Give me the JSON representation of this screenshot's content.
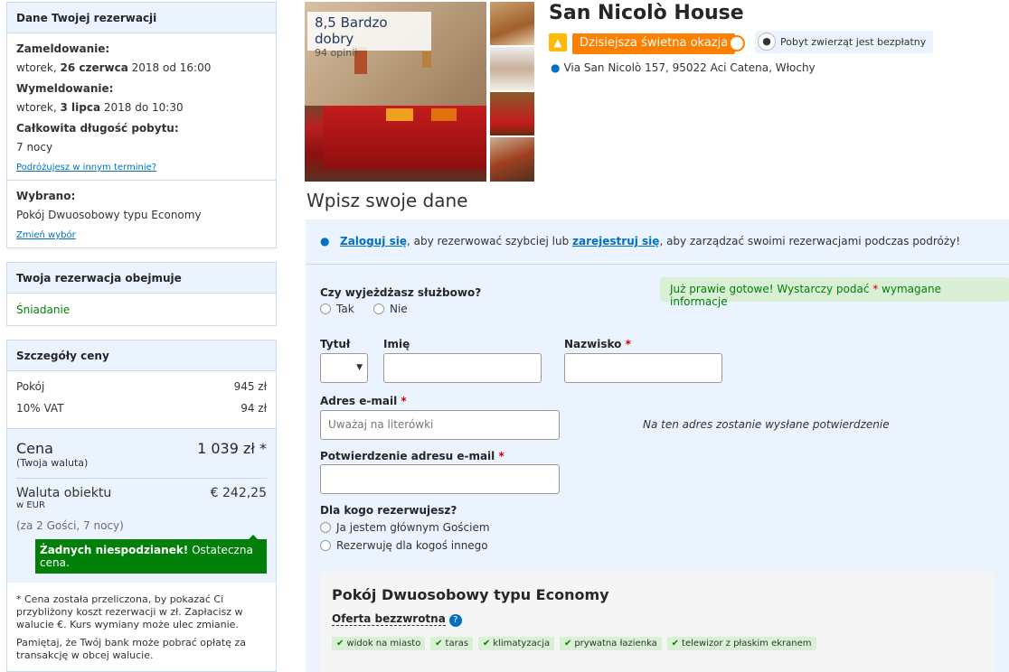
{
  "sidebar": {
    "reservation": {
      "title": "Dane Twojej rezerwacji",
      "checkin_label": "Zameldowanie:",
      "checkin_day": "wtorek, ",
      "checkin_date": "26 czerwca",
      "checkin_rest": " 2018 od 16:00",
      "checkout_label": "Wymeldowanie:",
      "checkout_day": "wtorek, ",
      "checkout_date": "3 lipca",
      "checkout_rest": " 2018 do 10:30",
      "length_label": "Całkowita długość pobytu:",
      "length_value": "7 nocy",
      "other_dates_link": "Podróżujesz w innym terminie?",
      "selected_label": "Wybrano:",
      "selected_value": "Pokój Dwuosobowy typu Economy",
      "change_link": "Zmień wybór"
    },
    "includes": {
      "title": "Twoja rezerwacja obejmuje",
      "item": "Śniadanie"
    },
    "price": {
      "title": "Szczegóły ceny",
      "room_label": "Pokój",
      "room_value": "945 zł",
      "vat_label": "10% VAT",
      "vat_value": "94 zł",
      "total_label": "Cena",
      "total_value": "1 039 zł *",
      "total_sub": "(Twoja waluta)",
      "property_currency_label": "Waluta obiektu",
      "property_currency_value": "€ 242,25",
      "property_currency_sub": "w EUR",
      "guests_note": "(za 2 Gości, 7 nocy)",
      "badge_bold": "Żadnych niespodzianek!",
      "badge_rest": " Ostateczna cena.",
      "note1": "* Cena została przeliczona, by pokazać Ci przybliżony koszt rezerwacji w zł. Zapłacisz w walucie €. Kurs wymiany może ulec zmianie.",
      "note2": "Pamiętaj, że Twój bank może pobrać opłatę za transakcję w obcej walucie."
    }
  },
  "hotel": {
    "score": "8,5 Bardzo dobry",
    "reviews": "94 opinii",
    "name": "San Nicolò House",
    "deal": "Dzisiejsza świetna okazja",
    "pets": "Pobyt zwierząt jest bezpłatny",
    "address": "Via San Nicolò 157, 95022 Aci Catena, Włochy"
  },
  "form": {
    "section_title": "Wpisz swoje dane",
    "login_link": "Zaloguj się",
    "login_mid": ", aby rezerwować szybciej lub ",
    "register_link": "zarejestruj się",
    "login_end": ", aby zarządzać swoimi rezerwacjami podczas podróży!",
    "ready_text": "Już prawie gotowe! Wystarczy podać ",
    "ready_star": "*",
    "ready_end": " wymagane informacje",
    "business_label": "Czy wyjeżdżasz służbowo?",
    "yes": "Tak",
    "no": "Nie",
    "title_label": "Tytuł",
    "firstname_label": "Imię",
    "lastname_label": "Nazwisko",
    "email_label": "Adres e-mail",
    "email_placeholder": "Uważaj na literówki",
    "email_hint": "Na ten adres zostanie wysłane potwierdzenie",
    "email_confirm_label": "Potwierdzenie adresu e-mail",
    "for_whom_label": "Dla kogo rezerwujesz?",
    "opt_main": "Ja jestem głównym Gościem",
    "opt_other": "Rezerwuję dla kogoś innego",
    "required_star": "*"
  },
  "room": {
    "title": "Pokój Dwuosobowy typu Economy",
    "offer": "Oferta bezzwrotna",
    "help": "?",
    "tags": [
      "widok na miasto",
      "taras",
      "klimatyzacja",
      "prywatna łazienka",
      "telewizor z płaskim ekranem"
    ]
  },
  "colors": {
    "accent": "#0071c2",
    "deal": "#ff8000",
    "green": "#008009",
    "panel": "#ebf3ff"
  }
}
